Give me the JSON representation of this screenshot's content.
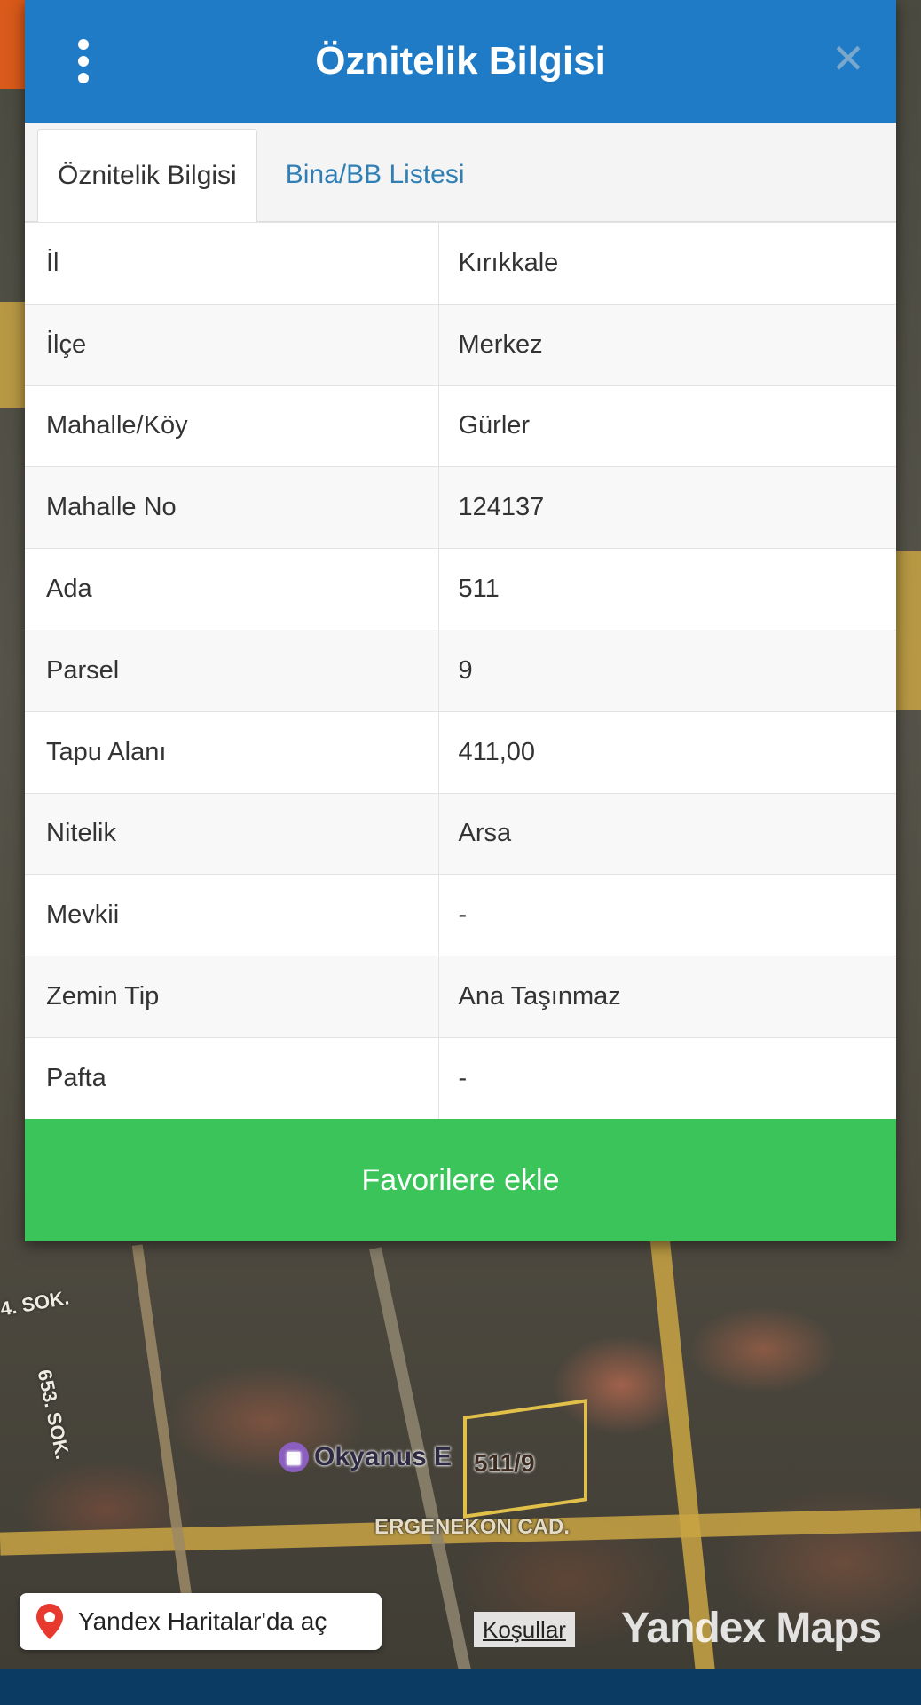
{
  "dialog": {
    "title": "Öznitelik Bilgisi",
    "tabs": [
      {
        "label": "Öznitelik Bilgisi",
        "active": true
      },
      {
        "label": "Bina/BB Listesi",
        "active": false
      }
    ],
    "rows": [
      {
        "key": "İl",
        "value": "Kırıkkale"
      },
      {
        "key": "İlçe",
        "value": "Merkez"
      },
      {
        "key": "Mahalle/Köy",
        "value": "Gürler"
      },
      {
        "key": "Mahalle No",
        "value": "124137"
      },
      {
        "key": "Ada",
        "value": "511"
      },
      {
        "key": "Parsel",
        "value": "9"
      },
      {
        "key": "Tapu Alanı",
        "value": "411,00"
      },
      {
        "key": "Nitelik",
        "value": "Arsa"
      },
      {
        "key": "Mevkii",
        "value": "-"
      },
      {
        "key": "Zemin Tip",
        "value": "Ana Taşınmaz"
      },
      {
        "key": "Pafta",
        "value": "-"
      }
    ],
    "favorite_button": "Favorilere ekle"
  },
  "map": {
    "parcel_label": "511/9",
    "poi_label": "Okyanus E",
    "street_ergenekon": "ERGENEKON CAD.",
    "street_653": "653. SOK.",
    "street_sok": "4. SOK.",
    "open_in_yandex": "Yandex Haritalar'da aç",
    "terms": "Koşullar",
    "brand": "Yandex Maps"
  },
  "colors": {
    "header": "#1f7bc5",
    "favorite": "#3ac45a",
    "tab_inactive": "#2f7fb5"
  }
}
